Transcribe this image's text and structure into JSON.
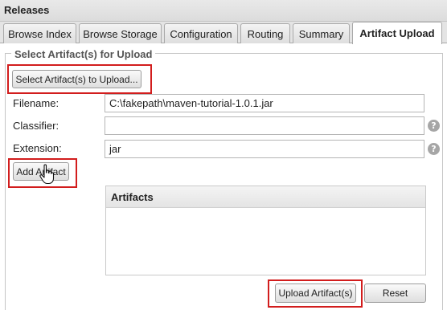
{
  "window": {
    "title": "Releases"
  },
  "tabs": [
    {
      "label": "Browse Index"
    },
    {
      "label": "Browse Storage"
    },
    {
      "label": "Configuration"
    },
    {
      "label": "Routing"
    },
    {
      "label": "Summary"
    },
    {
      "label": "Artifact Upload",
      "active": true
    }
  ],
  "upload_form": {
    "section_title": "Select Artifact(s) for Upload",
    "select_button_label": "Select Artifact(s) to Upload...",
    "filename": {
      "label": "Filename:",
      "value": "C:\\fakepath\\maven-tutorial-1.0.1.jar"
    },
    "classifier": {
      "label": "Classifier:",
      "value": ""
    },
    "extension": {
      "label": "Extension:",
      "value": "jar"
    },
    "help_glyph": "?",
    "add_button_label": "Add Artifact",
    "artifacts_header": "Artifacts",
    "upload_button_label": "Upload Artifact(s)",
    "reset_button_label": "Reset"
  },
  "colors": {
    "highlight": "#d21d1d",
    "help_icon": "#a6a6a6",
    "tab_border": "#a9a9a9"
  },
  "icons": [
    "help-icon",
    "hand-pointer-cursor"
  ]
}
